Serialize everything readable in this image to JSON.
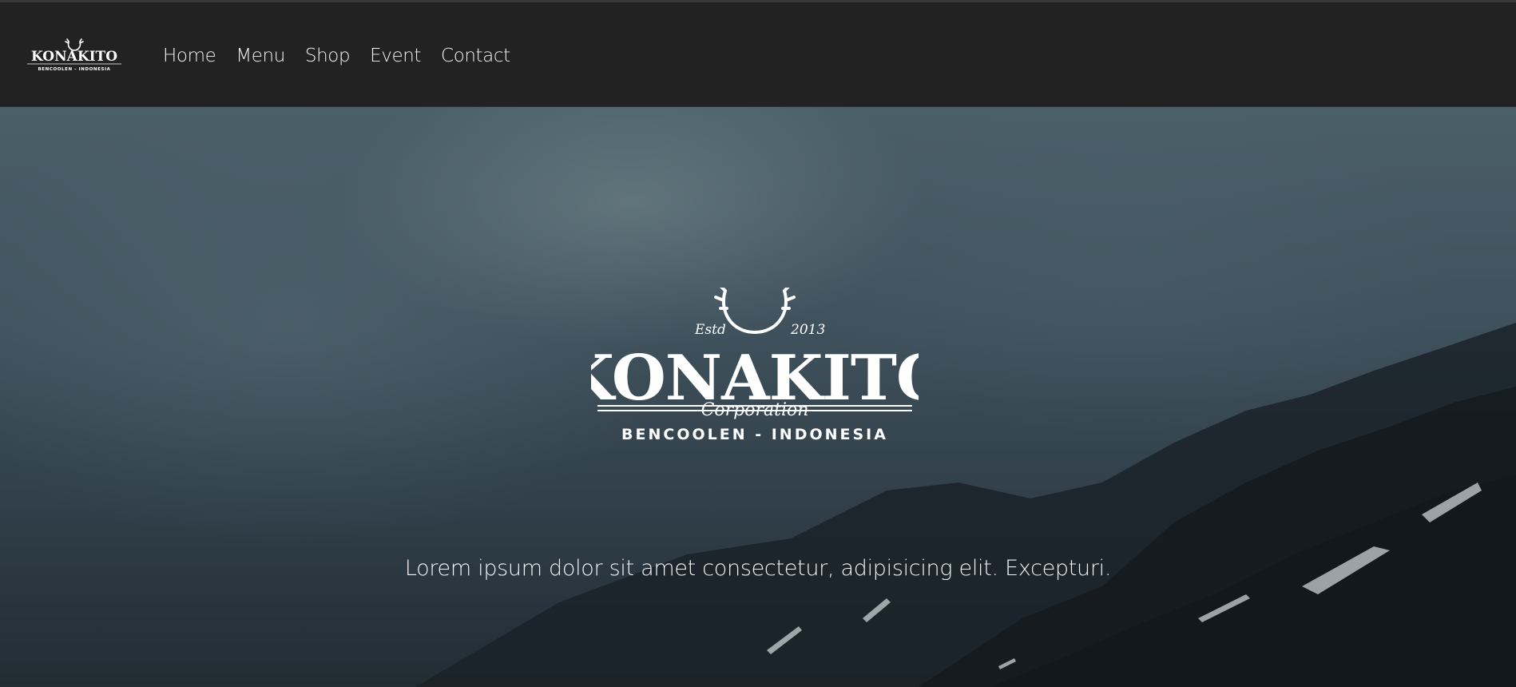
{
  "brand": {
    "logo_name": "KONAKITO",
    "logo_sub": "BENCOOLEN - INDONESIA",
    "hero_logo_estd": "Estd",
    "hero_logo_year": "2013",
    "hero_logo_name": "KONAKITO",
    "hero_logo_script": "Corporation",
    "hero_logo_location": "BENCOOLEN - INDONESIA"
  },
  "nav": {
    "items": [
      {
        "label": "Home"
      },
      {
        "label": "Menu"
      },
      {
        "label": "Shop"
      },
      {
        "label": "Event"
      },
      {
        "label": "Contact"
      }
    ]
  },
  "hero": {
    "tagline": "Lorem ipsum dolor sit amet consectetur, adipisicing elit. Excepturi."
  },
  "colors": {
    "navbar_bg": "#222222",
    "nav_text": "#f2f2f2",
    "hero_text": "#f4f4f4"
  },
  "icons": {
    "brand": "antlers-logo-icon"
  }
}
